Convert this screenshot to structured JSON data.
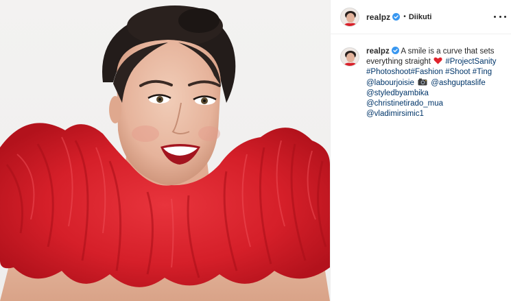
{
  "post": {
    "photo_alt": "",
    "header": {
      "username": "realpz",
      "separator": "•",
      "follow_label": "Diikuti"
    },
    "caption": {
      "username": "realpz",
      "text_1": "A smile is a curve that sets everything straight",
      "heart_emoji": "❤️",
      "hashtags": [
        "#ProjectSanity",
        "#Photoshoot",
        "#Fashion",
        "#Shoot",
        "#Ting"
      ],
      "mention_1": "@labourjoisie",
      "camera_emoji": "📷",
      "mentions": [
        "@ashguptaslife",
        "@styledbyambika",
        "@christinetirado_mua",
        "@vladimirsimic1"
      ]
    }
  },
  "colors": {
    "link": "#003569",
    "verified": "#3897f0",
    "dress_red": "#d9202a",
    "border": "#efefef"
  },
  "icons": {
    "verified": "verified-badge-icon",
    "more": "more-options-icon",
    "heart": "red-heart-emoji",
    "camera": "camera-emoji"
  }
}
